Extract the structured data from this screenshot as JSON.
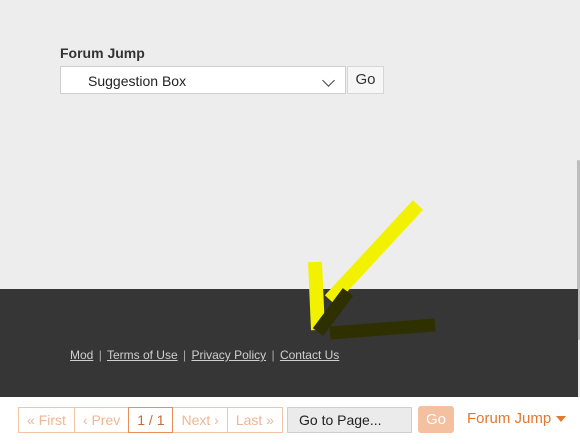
{
  "forum_jump": {
    "label": "Forum Jump",
    "selected": "Suggestion Box",
    "go_label": "Go"
  },
  "footer": {
    "links": [
      "Mod",
      "Terms of Use",
      "Privacy Policy",
      "Contact Us"
    ],
    "separator": "|"
  },
  "pagination": {
    "first": "« First",
    "prev": "‹ Prev",
    "current": "1 / 1",
    "next": "Next ›",
    "last": "Last »",
    "goto_placeholder": "Go to Page...",
    "go_label": "Go",
    "forum_jump_label": "Forum Jump"
  },
  "colors": {
    "accent": "#e4772f",
    "footer_bg": "#363636",
    "page_bg": "#ededed",
    "annotation_yellow": "#f2f200",
    "annotation_dark": "#2f3000"
  }
}
